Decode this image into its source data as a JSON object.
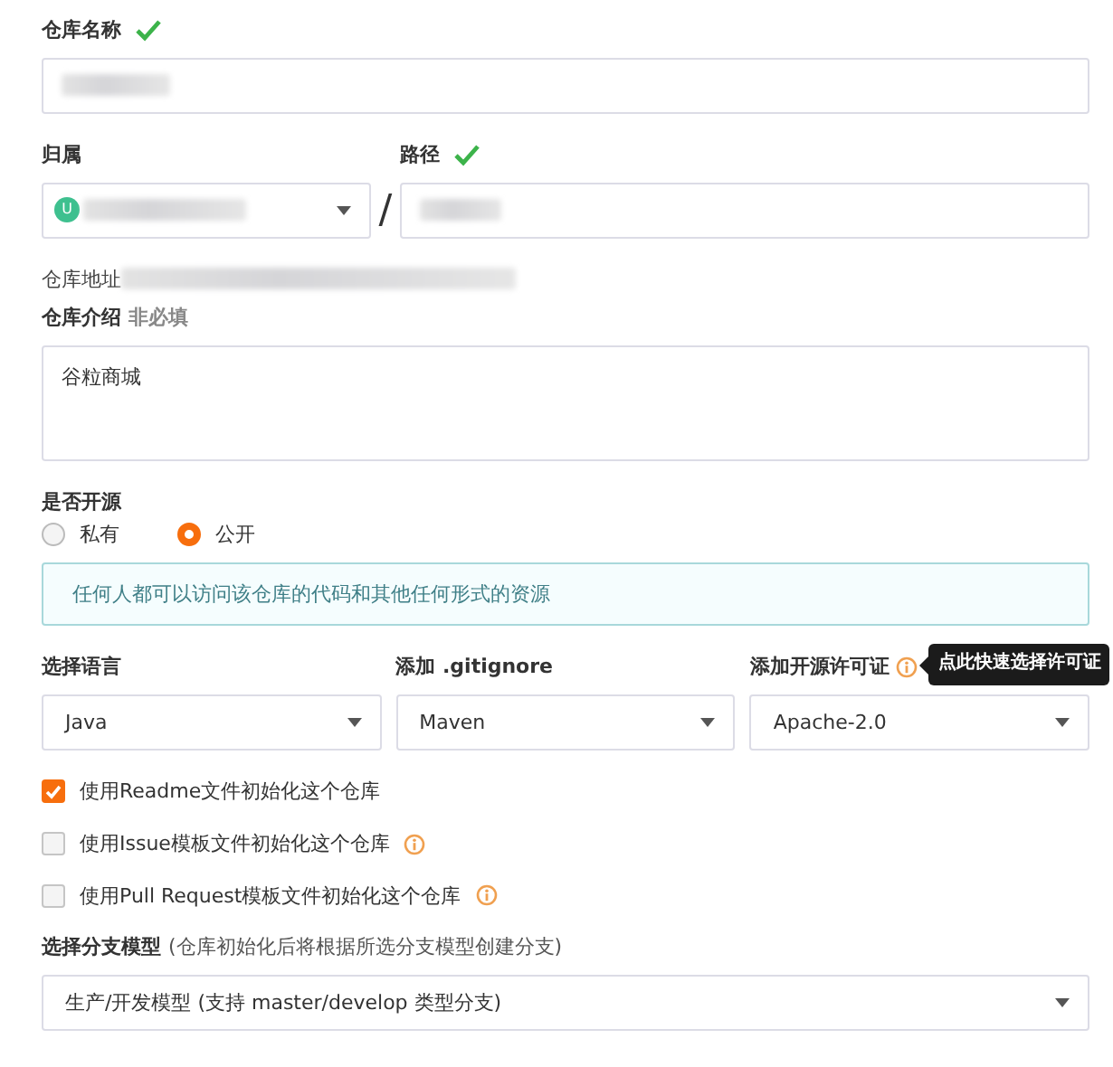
{
  "name_field": {
    "label": "仓库名称",
    "verified": true,
    "redacted": true
  },
  "owner_field": {
    "label": "归属",
    "avatar": "U",
    "redacted": true
  },
  "separator": "/",
  "path_field": {
    "label": "路径",
    "verified": true,
    "redacted": true
  },
  "address": {
    "label": "仓库地址",
    "redacted": true
  },
  "description": {
    "label": "仓库介绍",
    "hint": "非必填",
    "value": "谷粒商城"
  },
  "visibility": {
    "label": "是否开源",
    "options": [
      {
        "label": "私有",
        "selected": false
      },
      {
        "label": "公开",
        "selected": true
      }
    ],
    "notice": "任何人都可以访问该仓库的代码和其他任何形式的资源"
  },
  "selects": [
    {
      "label": "选择语言",
      "value": "Java",
      "info": false
    },
    {
      "label": "添加 .gitignore",
      "value": "Maven",
      "info": false
    },
    {
      "label": "添加开源许可证",
      "value": "Apache-2.0",
      "info": true,
      "tooltip": "点此快速选择许可证"
    }
  ],
  "init_options": [
    {
      "label": "使用Readme文件初始化这个仓库",
      "checked": true,
      "info": false
    },
    {
      "label": "使用Issue模板文件初始化这个仓库",
      "checked": false,
      "info": true
    },
    {
      "label": "使用Pull Request模板文件初始化这个仓库",
      "checked": false,
      "info": true
    }
  ],
  "branch_model": {
    "label": "选择分支模型",
    "hint": "(仓库初始化后将根据所选分支模型创建分支)",
    "value": "生产/开发模型 (支持 master/develop 类型分支)"
  }
}
